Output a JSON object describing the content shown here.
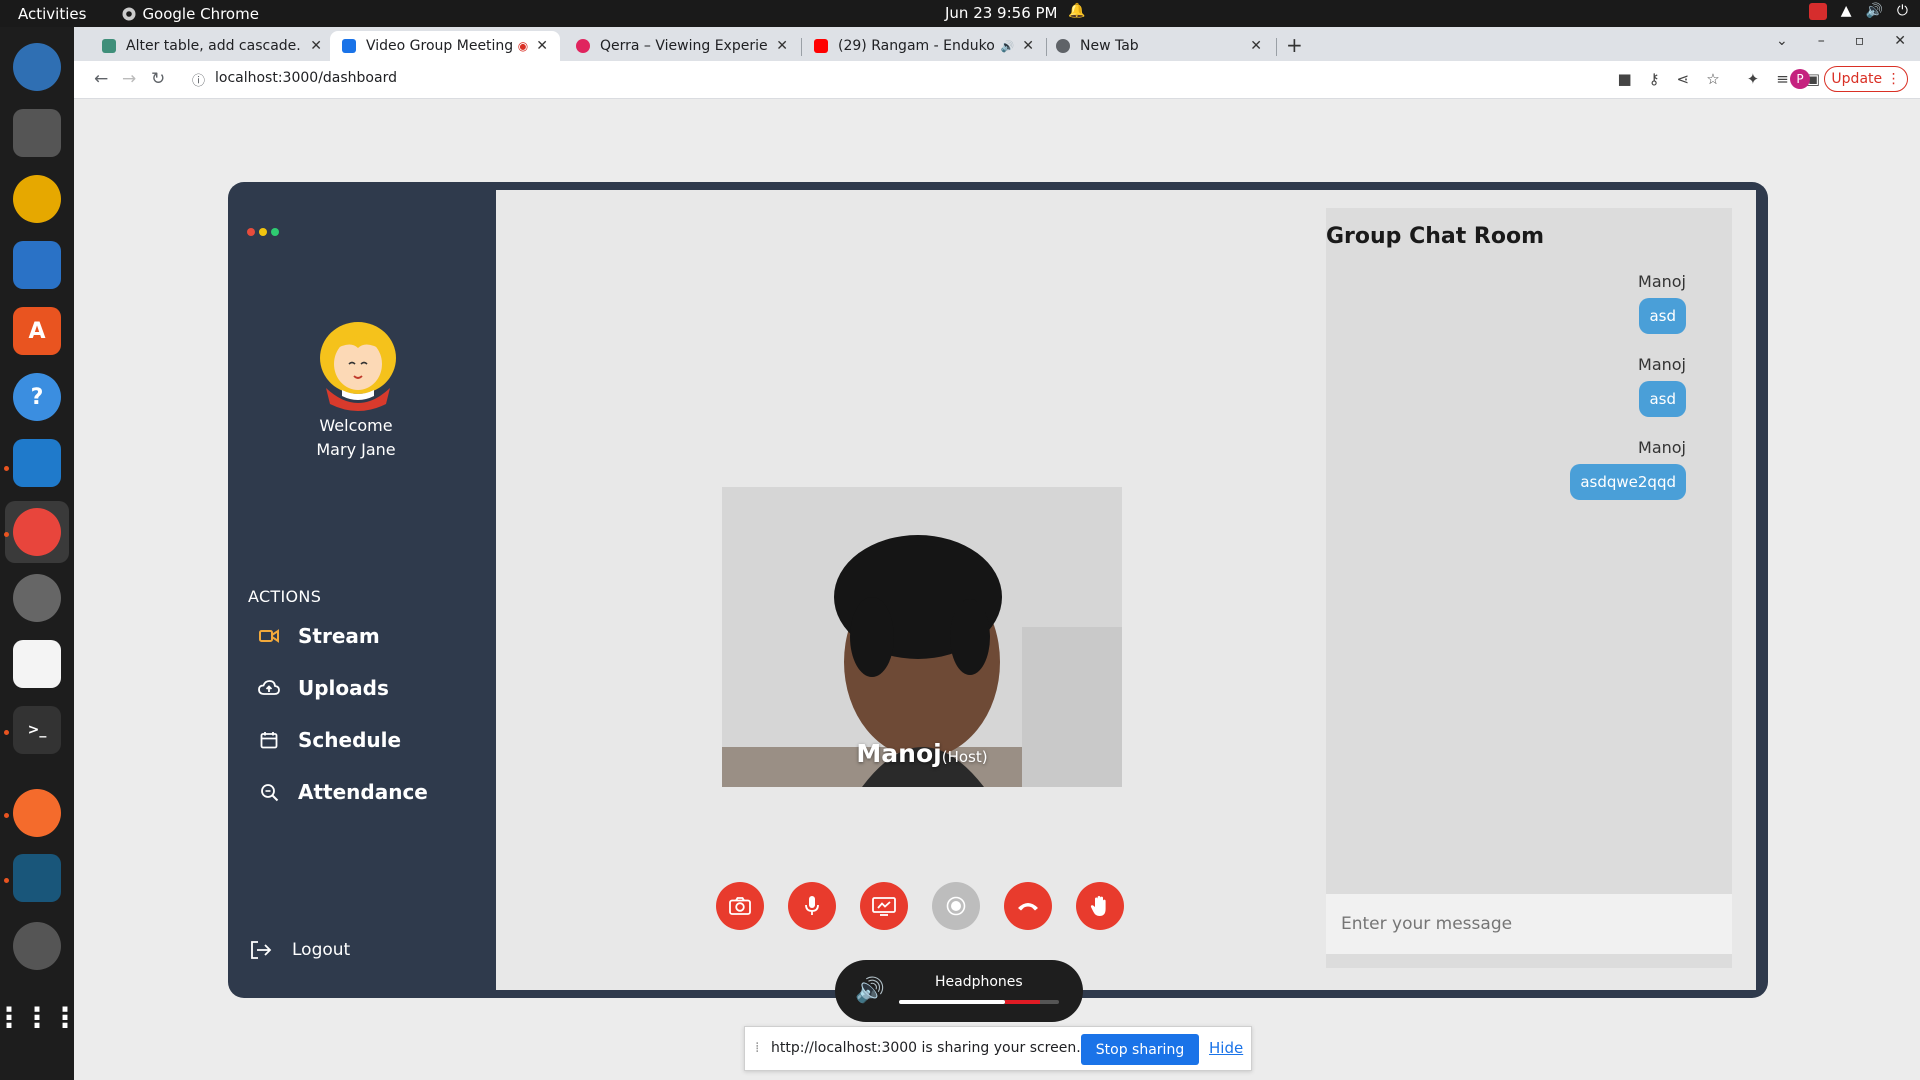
{
  "system": {
    "activities": "Activities",
    "app_name": "Google Chrome",
    "clock": "Jun 23  9:56 PM"
  },
  "browser": {
    "tabs": [
      {
        "title": "Alter table, add cascade.",
        "favicon_color": "#3f8f7a"
      },
      {
        "title": "Video Group Meeting",
        "favicon_color": "#1a73e8"
      },
      {
        "title": "Qerra – Viewing Experien",
        "favicon_color": "#e0245e"
      },
      {
        "title": "(29) Rangam - Enduko",
        "favicon_color": "#ff0000"
      },
      {
        "title": "New Tab",
        "favicon_color": "#5f6368"
      }
    ],
    "url": "localhost:3000/dashboard",
    "update_label": "Update",
    "profile_initial": "P"
  },
  "sidebar": {
    "welcome_line1": "Welcome",
    "welcome_line2": "Mary Jane",
    "actions_heading": "ACTIONS",
    "items": [
      {
        "label": "Stream",
        "icon": "video-icon"
      },
      {
        "label": "Uploads",
        "icon": "cloud-upload-icon"
      },
      {
        "label": "Schedule",
        "icon": "calendar-icon"
      },
      {
        "label": "Attendance",
        "icon": "search-zoom-icon"
      }
    ],
    "logout_label": "Logout"
  },
  "video": {
    "participant_name": "Manoj",
    "participant_role": "(Host)"
  },
  "controls": [
    {
      "name": "camera",
      "icon": "camera-icon",
      "enabled": true
    },
    {
      "name": "microphone",
      "icon": "microphone-icon",
      "enabled": true
    },
    {
      "name": "screen-share",
      "icon": "screen-share-icon",
      "enabled": true
    },
    {
      "name": "record",
      "icon": "record-icon",
      "enabled": false
    },
    {
      "name": "end-call",
      "icon": "phone-hangup-icon",
      "enabled": true
    },
    {
      "name": "raise-hand",
      "icon": "hand-icon",
      "enabled": true
    }
  ],
  "chat": {
    "title": "Group Chat Room",
    "messages": [
      {
        "sender": "Manoj",
        "text": "asd"
      },
      {
        "sender": "Manoj",
        "text": "asd"
      },
      {
        "sender": "Manoj",
        "text": "asdqwe2qqd"
      }
    ],
    "input_placeholder": "Enter your message"
  },
  "volume_osd": {
    "device": "Headphones",
    "level": 0.66,
    "boost_level": 0.88
  },
  "share_bar": {
    "text": "http://localhost:3000 is sharing your screen.",
    "stop_label": "Stop sharing",
    "hide_label": "Hide"
  },
  "colors": {
    "accent_red": "#e83b2d",
    "sidebar_bg": "#2f3a4c",
    "chat_bubble": "#4a9fd8",
    "stream_icon": "#f2a93b"
  }
}
